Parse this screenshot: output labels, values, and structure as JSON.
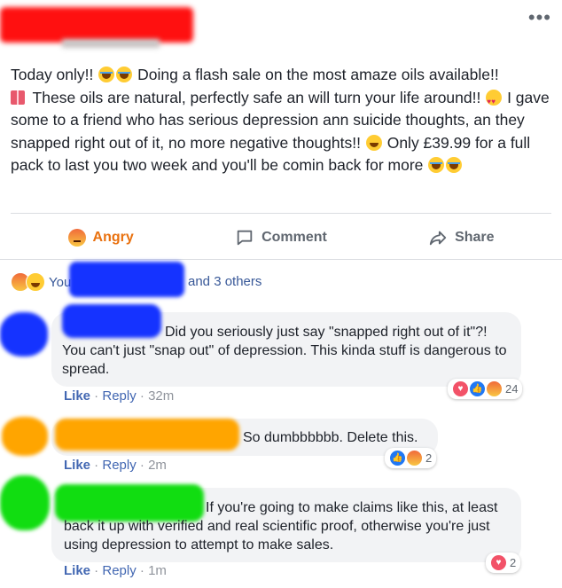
{
  "post": {
    "text_segments": [
      "Today only!! ",
      " Doing a flash sale on the most amaze oils available!! ",
      " These oils are natural, perfectly safe an will turn your life around!! ",
      " I gave some to a friend who has serious depression ann suicide thoughts, an they snapped right out of it, no more negative thoughts!! ",
      " Only £39.99 for a full pack to last you two week and you'll be comin back for more "
    ],
    "more_options": "•••"
  },
  "actions": {
    "angry": "Angry",
    "comment": "Comment",
    "share": "Share"
  },
  "reactions_summary": {
    "you": "You",
    "others": "and 3 others"
  },
  "comments": [
    {
      "text": "Did you seriously just say \"snapped right out of it\"?! You can't just \"snap out\" of depression. This kinda stuff is dangerous to spread.",
      "like": "Like",
      "reply": "Reply",
      "time": "32m",
      "reaction_count": "24"
    },
    {
      "text": "So dumbbbbbb. Delete this.",
      "like": "Like",
      "reply": "Reply",
      "time": "2m",
      "reaction_count": "2"
    },
    {
      "text": "If you're going to make claims like this, at least back it up with verified and real scientific proof, otherwise you're just using depression to attempt to make sales.",
      "like": "Like",
      "reply": "Reply",
      "time": "1m",
      "reaction_count": "2"
    }
  ],
  "colors": {
    "post_author_redaction": "#ff1010",
    "comment1_redaction": "#1533ff",
    "comment2_redaction": "#ffa500",
    "comment3_redaction": "#11dd11",
    "angry_accent": "#e9710f",
    "link": "#4267b2"
  }
}
